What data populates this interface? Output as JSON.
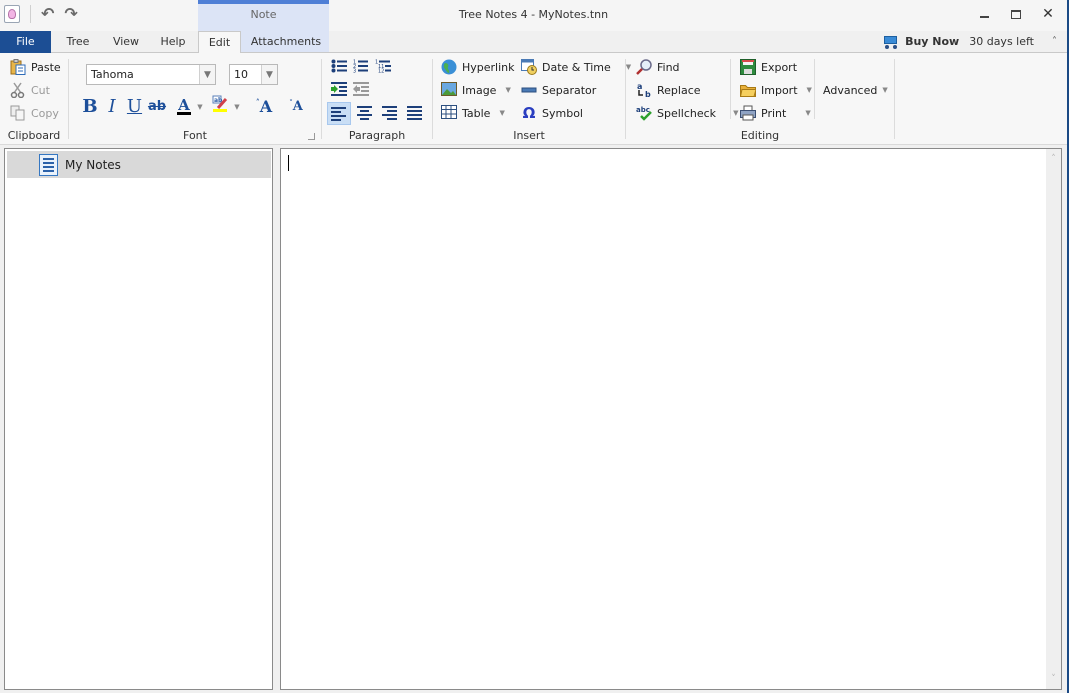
{
  "window": {
    "title": "Tree Notes 4 - MyNotes.tnn",
    "context_group_label": "Note",
    "controls": {
      "minimize": "minimize",
      "maximize": "maximize",
      "close": "✕"
    }
  },
  "quick_access": {
    "undo": "↶",
    "redo": "↷"
  },
  "tabs": [
    {
      "label": "File"
    },
    {
      "label": "Tree"
    },
    {
      "label": "View"
    },
    {
      "label": "Help"
    },
    {
      "label": "Edit",
      "active": true
    },
    {
      "label": "Attachments"
    }
  ],
  "buy": {
    "label": "Buy Now",
    "trial": "30 days left",
    "collapse": "˄"
  },
  "ribbon": {
    "clipboard": {
      "label": "Clipboard",
      "paste": "Paste",
      "cut": "Cut",
      "copy": "Copy"
    },
    "font": {
      "label": "Font",
      "family": "Tahoma",
      "size": "10",
      "bold": "B",
      "italic": "I",
      "underline": "U",
      "strike": "ab",
      "font_color": "A",
      "grow": "A",
      "shrink": "A",
      "colors": {
        "font_color": "#000000",
        "highlight": "#ffff00"
      }
    },
    "paragraph": {
      "label": "Paragraph",
      "alignment": "left"
    },
    "insert": {
      "label": "Insert",
      "hyperlink": "Hyperlink",
      "image": "Image",
      "table": "Table",
      "datetime": "Date & Time",
      "separator": "Separator",
      "symbol": "Symbol"
    },
    "editing": {
      "label": "Editing",
      "find": "Find",
      "replace": "Replace",
      "spellcheck": "Spellcheck",
      "export": "Export",
      "import": "Import",
      "print": "Print",
      "advanced": "Advanced"
    }
  },
  "tree": {
    "items": [
      {
        "label": "My Notes",
        "selected": true
      }
    ]
  },
  "editor": {
    "content": ""
  },
  "scroll": {
    "up": "˄",
    "down": "˅"
  },
  "dropdown_glyph": "▼"
}
